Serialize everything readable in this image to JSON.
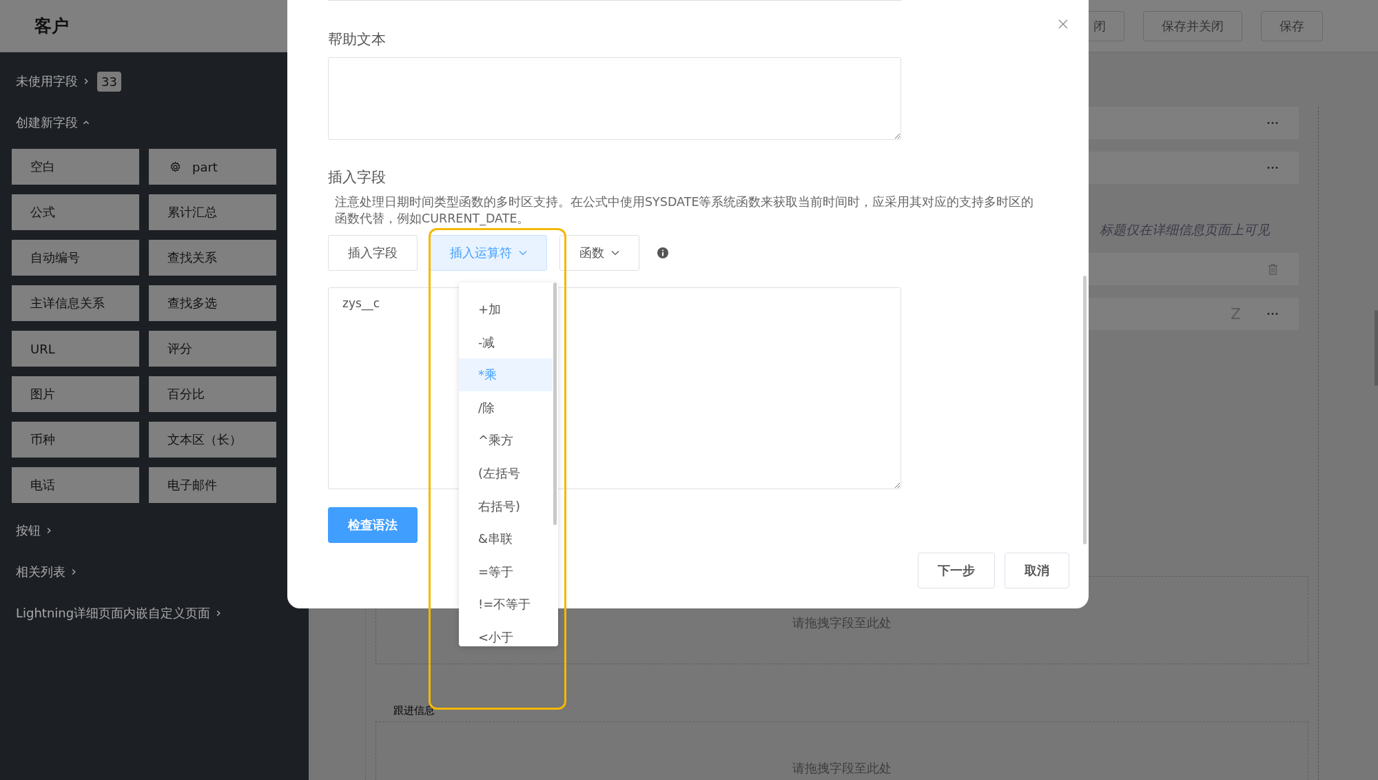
{
  "header": {
    "title": "客户",
    "actions": [
      "闭",
      "保存并关闭",
      "保存"
    ]
  },
  "sidebar": {
    "unused": {
      "label": "未使用字段",
      "count": "33",
      "expanded": false
    },
    "create": {
      "label": "创建新字段",
      "expanded": true
    },
    "field_types": [
      {
        "label": "空白",
        "kind": "standard"
      },
      {
        "label": "part",
        "kind": "custom"
      },
      {
        "label": "公式",
        "kind": "standard"
      },
      {
        "label": "累计汇总",
        "kind": "standard"
      },
      {
        "label": "自动编号",
        "kind": "standard"
      },
      {
        "label": "查找关系",
        "kind": "standard"
      },
      {
        "label": "主详信息关系",
        "kind": "standard"
      },
      {
        "label": "查找多选",
        "kind": "standard"
      },
      {
        "label": "URL",
        "kind": "standard"
      },
      {
        "label": "评分",
        "kind": "standard"
      },
      {
        "label": "图片",
        "kind": "standard"
      },
      {
        "label": "百分比",
        "kind": "standard"
      },
      {
        "label": "币种",
        "kind": "standard"
      },
      {
        "label": "文本区（长）",
        "kind": "standard"
      },
      {
        "label": "电话",
        "kind": "standard"
      },
      {
        "label": "电子邮件",
        "kind": "standard"
      }
    ],
    "sections": [
      {
        "label": "按钮",
        "expanded": false
      },
      {
        "label": "相关列表",
        "expanded": false
      },
      {
        "label": "Lightning详细页面内嵌自定义页面",
        "expanded": false
      }
    ]
  },
  "canvas": {
    "items": [
      {
        "kind": "menu_row"
      },
      {
        "kind": "menu_row"
      },
      {
        "kind": "hint",
        "text": "标题仅在详细信息页面上可见"
      },
      {
        "kind": "delete_row"
      },
      {
        "kind": "menu_row",
        "letter": "Z"
      }
    ],
    "sections": [
      {
        "drop_hint": "请拖拽字段至此处"
      },
      {
        "title": "跟进信息",
        "drop_hint": "请拖拽字段至此处"
      }
    ]
  },
  "dialog": {
    "help_label": "帮助文本",
    "insert_label": "插入字段",
    "note": "注意处理日期时间类型函数的多时区支持。在公式中使用SYSDATE等系统函数来获取当前时间时，应采用其对应的支持多时区的函数代替，例如CURRENT_DATE。",
    "tools": [
      {
        "label": "插入字段",
        "kind": "plain",
        "selected": false
      },
      {
        "label": "插入运算符",
        "kind": "dropdown",
        "selected": true
      },
      {
        "label": "函数",
        "kind": "dropdown",
        "selected": false
      }
    ],
    "formula": "zys__c",
    "operators": [
      {
        "label": "+加",
        "selected": false
      },
      {
        "label": "-减",
        "selected": false
      },
      {
        "label": "*乘",
        "selected": true
      },
      {
        "label": "/除",
        "selected": false
      },
      {
        "label": "^乘方",
        "selected": false
      },
      {
        "label": "(左括号",
        "selected": false
      },
      {
        "label": "右括号)",
        "selected": false
      },
      {
        "label": "&串联",
        "selected": false
      },
      {
        "label": "=等于",
        "selected": false
      },
      {
        "label": "!=不等于",
        "selected": false
      },
      {
        "label": "<小于",
        "selected": false
      }
    ],
    "check_button": "检查语法",
    "footer_buttons": [
      "下一步",
      "取消"
    ]
  }
}
